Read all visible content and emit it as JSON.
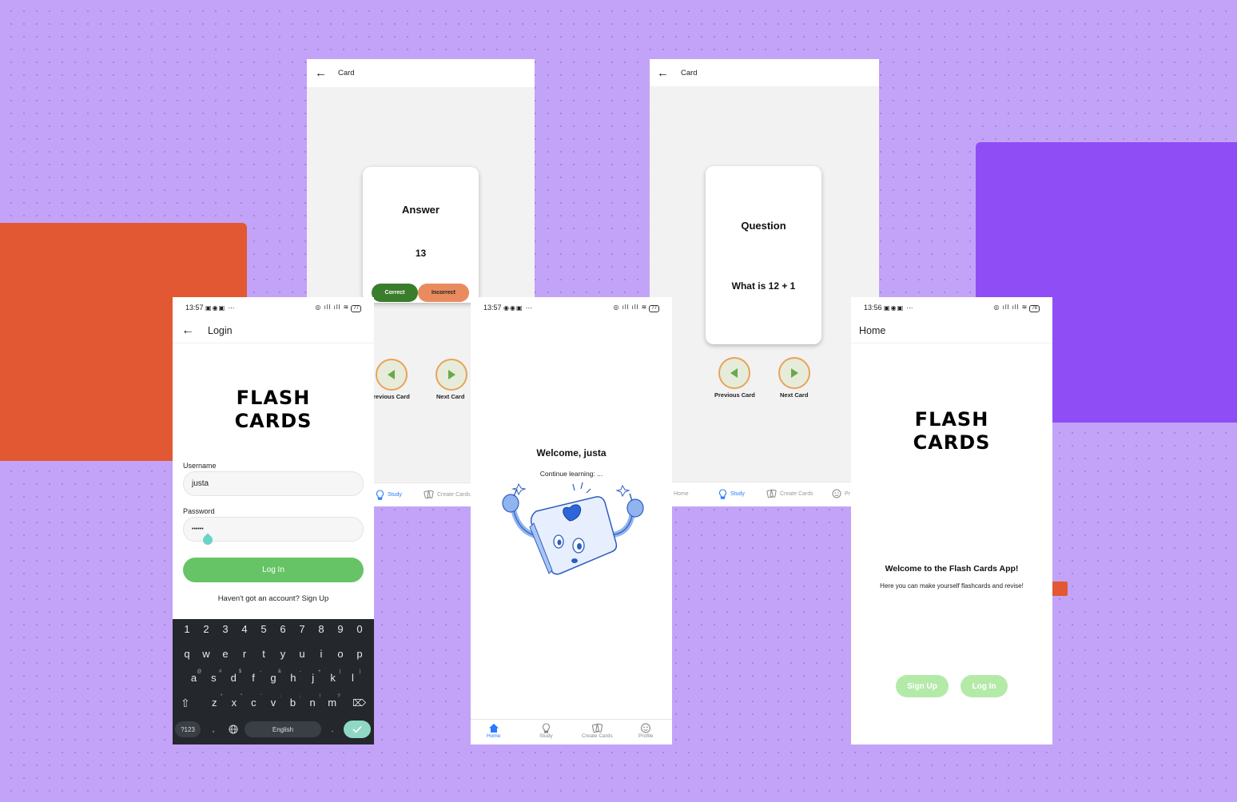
{
  "colors": {
    "background": "#c3a3f7",
    "accent_orange": "#e25833",
    "accent_purple": "#8f4df5",
    "correct": "#3a7d2c",
    "incorrect": "#e98b5e",
    "login_button": "#66c466",
    "home_buttons": "#b4eaa8",
    "active_tab": "#2979ff"
  },
  "answer_screen": {
    "title": "Card",
    "card_heading": "Answer",
    "card_value": "13",
    "correct_label": "Correct",
    "incorrect_label": "Incorrect",
    "prev_label": "Previous Card",
    "next_label": "Next Card",
    "tabs": [
      {
        "label": "Study",
        "icon": "lightbulb-icon",
        "active": true
      },
      {
        "label": "Create Cards",
        "icon": "cards-icon",
        "active": false
      }
    ]
  },
  "question_screen": {
    "title": "Card",
    "card_heading": "Question",
    "card_value": "What is 12 + 1",
    "prev_label": "Previous Card",
    "next_label": "Next Card",
    "tabs": [
      {
        "label": "Home",
        "icon": "home-icon",
        "active": false
      },
      {
        "label": "Study",
        "icon": "lightbulb-icon",
        "active": true
      },
      {
        "label": "Create Cards",
        "icon": "cards-icon",
        "active": false
      },
      {
        "label": "Pr",
        "icon": "profile-icon",
        "active": false
      }
    ]
  },
  "login_screen": {
    "status_time": "13:57",
    "battery": "77",
    "title": "Login",
    "logo_line1": "FLASH",
    "logo_line2": "CARDS",
    "username_label": "Username",
    "username_value": "justa",
    "password_label": "Password",
    "password_value": "••••••",
    "login_button": "Log In",
    "signup_prompt": "Haven't got an account? Sign Up",
    "keyboard": {
      "numbers": [
        "1",
        "2",
        "3",
        "4",
        "5",
        "6",
        "7",
        "8",
        "9",
        "0"
      ],
      "row1": [
        "q",
        "w",
        "e",
        "r",
        "t",
        "y",
        "u",
        "i",
        "o",
        "p"
      ],
      "row2": [
        "a",
        "s",
        "d",
        "f",
        "g",
        "h",
        "j",
        "k",
        "l"
      ],
      "row2_alt": [
        "@",
        "#",
        "$",
        "-",
        "&",
        "-",
        "+",
        "(",
        ")"
      ],
      "row3": [
        "z",
        "x",
        "c",
        "v",
        "b",
        "n",
        "m"
      ],
      "row3_alt": [
        "*",
        "\"",
        "'",
        ":",
        ";",
        "!",
        "?"
      ],
      "symbols_key": "?123",
      "comma_key": ",",
      "space_label": "English",
      "period_key": "."
    }
  },
  "welcome_screen": {
    "status_time": "13:57",
    "battery": "77",
    "heading": "Welcome, justa",
    "subtext": "Continue learning: ...",
    "tabs": [
      {
        "label": "Home",
        "icon": "home-icon",
        "active": true
      },
      {
        "label": "Study",
        "icon": "lightbulb-icon",
        "active": false
      },
      {
        "label": "Create Cards",
        "icon": "cards-icon",
        "active": false
      },
      {
        "label": "Profile",
        "icon": "profile-icon",
        "active": false
      }
    ]
  },
  "home_screen": {
    "status_time": "13:56",
    "battery": "78",
    "title": "Home",
    "logo_line1": "FLASH",
    "logo_line2": "CARDS",
    "heading": "Welcome to the Flash Cards App!",
    "subtext": "Here you can make yourself flashcards and revise!",
    "signup_button": "Sign Up",
    "login_button": "Log In"
  }
}
